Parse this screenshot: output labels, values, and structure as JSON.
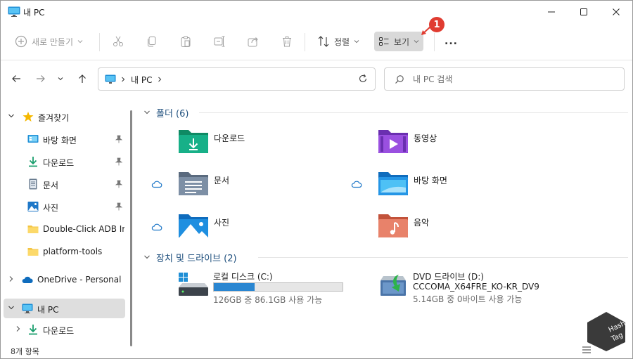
{
  "window": {
    "title": "내 PC"
  },
  "toolbar": {
    "new_label": "새로 만들기",
    "sort_label": "정렬",
    "view_label": "보기",
    "more_label": "...",
    "badge_number": "1"
  },
  "address": {
    "segment": "내 PC",
    "search_placeholder": "내 PC 검색"
  },
  "sidebar": {
    "quick_access": "즐겨찾기",
    "items": [
      {
        "label": "바탕 화면",
        "icon": "desktop-icon",
        "pinned": true
      },
      {
        "label": "다운로드",
        "icon": "download-icon",
        "pinned": true
      },
      {
        "label": "문서",
        "icon": "document-icon",
        "pinned": true
      },
      {
        "label": "사진",
        "icon": "pictures-icon",
        "pinned": true
      },
      {
        "label": "Double-Click ADB Ins",
        "icon": "folder-icon",
        "pinned": false
      },
      {
        "label": "platform-tools",
        "icon": "folder-icon",
        "pinned": false
      }
    ],
    "onedrive": "OneDrive - Personal",
    "this_pc": "내 PC",
    "downloads_sub": "다운로드"
  },
  "content": {
    "folders_header": "폴더 (6)",
    "folders": [
      {
        "label": "다운로드",
        "icon": "downloads-folder-icon"
      },
      {
        "label": "동영상",
        "icon": "videos-folder-icon"
      },
      {
        "label": "문서",
        "icon": "documents-folder-icon",
        "cloud": true
      },
      {
        "label": "바탕 화면",
        "icon": "desktop-folder-icon",
        "cloud": true
      },
      {
        "label": "사진",
        "icon": "pictures-folder-icon",
        "cloud": true
      },
      {
        "label": "음악",
        "icon": "music-folder-icon"
      }
    ],
    "drives_header": "장치 및 드라이브 (2)",
    "drives": [
      {
        "name": "로컬 디스크 (C:)",
        "subtitle": "126GB 중 86.1GB 사용 가능",
        "used_fraction": 0.317
      },
      {
        "name": "DVD 드라이브 (D:)",
        "volume": "CCCOMA_X64FRE_KO-KR_DV9",
        "subtitle": "5.14GB 중 0바이트 사용 가능"
      }
    ]
  },
  "status": {
    "count": "8개 항목"
  },
  "colors": {
    "accent": "#2a86d1",
    "section_text": "#1e4f7d",
    "badge": "#e03c31",
    "selected_bg": "#dedede"
  }
}
